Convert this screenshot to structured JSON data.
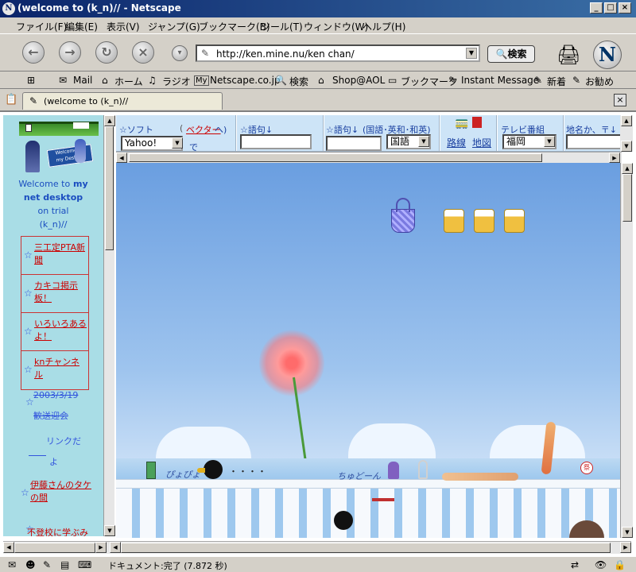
{
  "window": {
    "title": "(welcome to (k_n)// - Netscape",
    "app_icon": "N"
  },
  "menu": [
    "ファイル(F)",
    "編集(E)",
    "表示(V)",
    "ジャンプ(G)",
    "ブックマーク(B)",
    "ツール(T)",
    "ウィンドウ(W)",
    "ヘルプ(H)"
  ],
  "nav": {
    "url": "http://ken.mine.nu/ken chan/",
    "search_label": "検索",
    "logo": "N"
  },
  "personal_toolbar": [
    "Mail",
    "ホーム",
    "ラジオ",
    "Netscape.co.jp",
    "検索",
    "Shop@AOL",
    "ブックマーク",
    "Instant Message",
    "新着",
    "お勧め"
  ],
  "tab": {
    "title": "(welcome to (k_n)//"
  },
  "top_frame": {
    "soft_label": "☆ソフト",
    "vector_link": "ベクター",
    "he": "へ)",
    "de": "で",
    "soft_value": "Yahoo!",
    "goku_label": "☆語句↓",
    "goku2_label": "☆語句↓",
    "goku2_sub": "(国語･英和･和英)",
    "dict_value": "国語",
    "route_link": "路線",
    "map_link": "地図",
    "tv_label": "テレビ番組",
    "tv_value": "福岡",
    "place_label": "地名か、〒↓"
  },
  "left_frame": {
    "welcome_1": "Welcome to",
    "welcome_2": "my",
    "welcome_3": "net desktop",
    "on_trial": "on trial",
    "kn": "(k_n)//",
    "links": [
      {
        "text": "三工定PTA新聞"
      },
      {
        "text": "カキコ掲示板！"
      },
      {
        "text": "いろいろあるよ！"
      },
      {
        "text": "knチャンネル"
      }
    ],
    "date_event_1": "2003/3/19",
    "date_event_2": "歓送迎会",
    "link_da": "リンクだ",
    "yo": "よ",
    "ito": "伊藤さんのタケの間",
    "futoko": "不登校に学ぶみちくさの会"
  },
  "main_frame": {
    "chorin": "ちゅどーん",
    "pyonpyon": "ぴょぴょ",
    "dots": "・・・・"
  },
  "status": {
    "text": "ドキュメント:完了 (7.872 秒)"
  }
}
